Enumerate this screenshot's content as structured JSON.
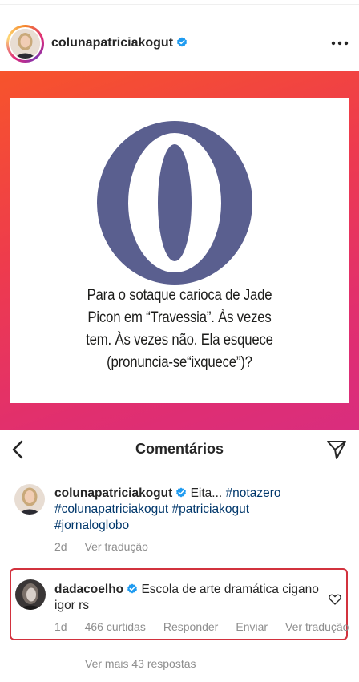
{
  "post": {
    "username": "colunapatriciakogut",
    "verified": true,
    "more_icon": "more-horizontal-icon",
    "card_logo": "O",
    "card_text_lines": [
      "Para o sotaque carioca de Jade",
      "Picon em “Travessia”. Às vezes",
      "tem. Às vezes não. Ela esquece",
      "(pronuncia-se“ixquece”)?"
    ],
    "colors": {
      "gradient_start": "#f7542b",
      "gradient_end": "#d92d7e",
      "logo": "#5a5f8f"
    }
  },
  "comments_header": {
    "title": "Comentários",
    "back_icon": "chevron-left-icon",
    "send_icon": "send-icon"
  },
  "comments": [
    {
      "username": "colunapatriciakogut",
      "verified": true,
      "text_plain": "Eita...",
      "hashtags": [
        "#notazero",
        "#colunapatriciakogut",
        "#patriciakogut",
        "#jornaloglobo"
      ],
      "time": "2d",
      "translate": "Ver tradução"
    },
    {
      "username": "dadacoelho",
      "verified": true,
      "text": "Escola de arte dramática cigano  igor rs",
      "time": "1d",
      "likes": "466 curtidas",
      "reply": "Responder",
      "send": "Enviar",
      "translate": "Ver tradução"
    }
  ],
  "more_replies": "Ver mais 43 respostas",
  "highlight_color": "#d2323e"
}
